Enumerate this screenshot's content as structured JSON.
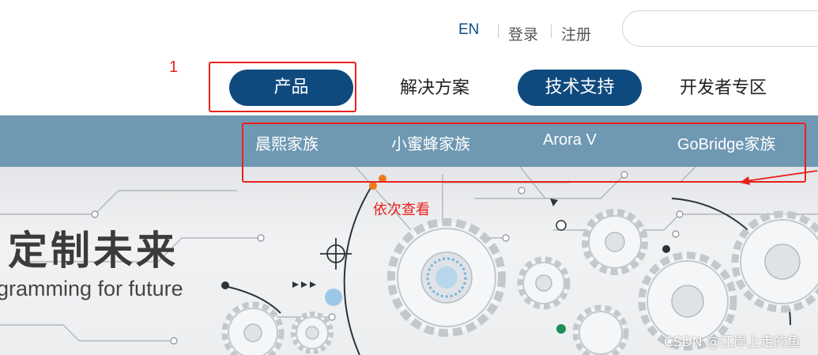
{
  "header": {
    "lang": "EN",
    "login": "登录",
    "register": "注册"
  },
  "nav": {
    "items": [
      {
        "label": "产品",
        "active": true
      },
      {
        "label": "解决方案",
        "active": false
      },
      {
        "label": "技术支持",
        "active": true
      },
      {
        "label": "开发者专区",
        "active": false
      }
    ]
  },
  "subnav": {
    "items": [
      "晨熙家族",
      "小蜜蜂家族",
      "Arora V",
      "GoBridge家族"
    ]
  },
  "annotations": {
    "step_number": "1",
    "note": "依次查看",
    "color": "#e8211d"
  },
  "banner": {
    "title": "定制未来",
    "subtitle": "gramming for future"
  },
  "watermark": "CSDN @江岸上走的鱼",
  "colors": {
    "brand": "#0f4a7f",
    "subnav_bg": "#6f98b3",
    "annotation": "#e8211d"
  }
}
